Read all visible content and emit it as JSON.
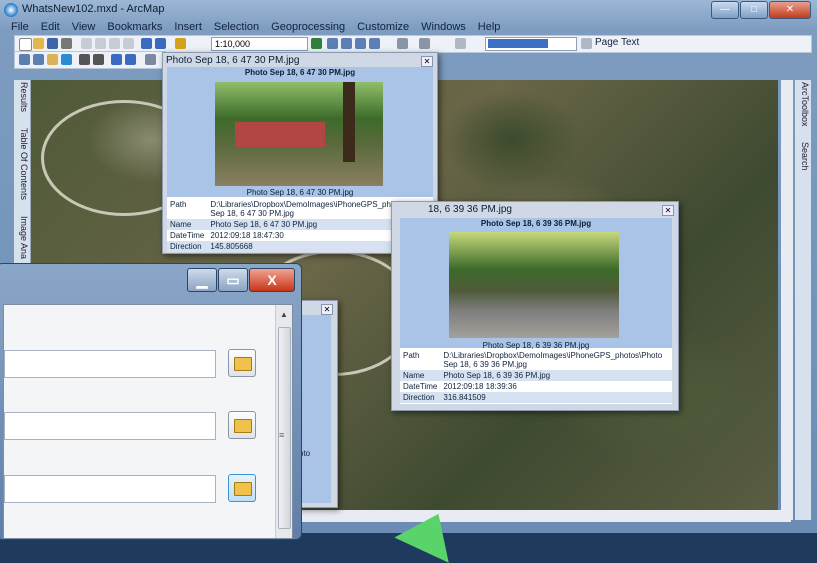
{
  "window": {
    "title": "WhatsNew102.mxd - ArcMap",
    "min": "—",
    "max": "□",
    "close": "✕"
  },
  "menu": [
    "File",
    "Edit",
    "View",
    "Bookmarks",
    "Insert",
    "Selection",
    "Geoprocessing",
    "Customize",
    "Windows",
    "Help"
  ],
  "toolbar": {
    "scale": "1:10,000",
    "page_text": "Page Text"
  },
  "left_tabs": [
    "Results",
    "Table Of Contents",
    "Image Ana"
  ],
  "right_tabs": [
    "ArcToolbox",
    "Search"
  ],
  "popup1": {
    "title": "Photo Sep 18, 6 47 30 PM.jpg",
    "header": "Photo Sep 18, 6 47 30 PM.jpg",
    "caption": "Photo Sep 18, 6 47 30 PM.jpg",
    "rows": [
      {
        "k": "Path",
        "v": "D:\\Libraries\\Dropbox\\DemoImages\\iPhoneGPS_photos\\Photo Sep 18, 6 47 30 PM.jpg"
      },
      {
        "k": "Name",
        "v": "Photo Sep 18, 6 47 30 PM.jpg"
      },
      {
        "k": "DateTime",
        "v": "2012:09:18 18:47:30"
      },
      {
        "k": "Direction",
        "v": "145.805668"
      }
    ]
  },
  "popup2": {
    "title": "Photo Sep 18, 6 39 36 PM.jpg",
    "title_visible": "18, 6 39 36 PM.jpg",
    "header": "Photo Sep 18, 6 39 36 PM.jpg",
    "caption": "Photo Sep 18, 6 39 36 PM.jpg",
    "rows": [
      {
        "k": "Path",
        "v": "D:\\Libraries\\Dropbox\\DemoImages\\iPhoneGPS_photos\\Photo Sep 18, 6 39 36 PM.jpg"
      },
      {
        "k": "Name",
        "v": "Photo Sep 18, 6 39 36 PM.jpg"
      },
      {
        "k": "DateTime",
        "v": "2012:09:18 18:39:36"
      },
      {
        "k": "Direction",
        "v": "316.841509"
      }
    ]
  },
  "popup3": {
    "partial_text": "oto"
  },
  "dialog": {
    "min": "▁",
    "max": "▭",
    "close": "X"
  },
  "colors": {
    "accent": "#3d6fc4",
    "close_red": "#c5361a",
    "popup_header": "#a9c4e6"
  }
}
